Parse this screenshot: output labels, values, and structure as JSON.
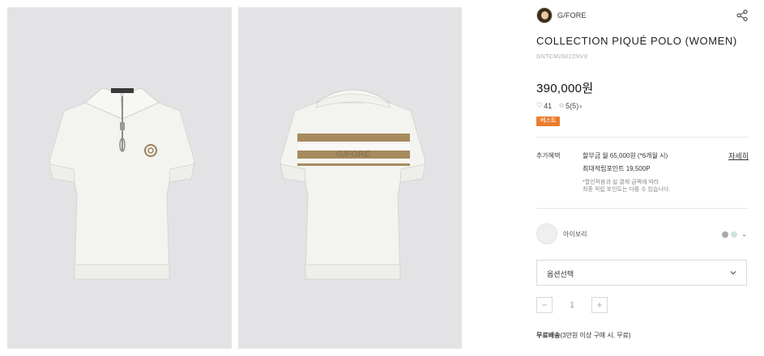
{
  "brand": {
    "name": "G/FORE",
    "logo": "brand-avatar"
  },
  "product": {
    "title": "COLLECTION PIQUÉ POLO (WOMEN)",
    "code": "GNTCM26022NVX",
    "price": "390,000원",
    "likes": "41",
    "rating": "5",
    "review_count": "(5)",
    "badge": "베스트"
  },
  "gallery": {
    "front_wordmark": "G/FORE",
    "back_wordmark": "G/FORE"
  },
  "benefits": {
    "label": "추가혜택",
    "installment": "할부금 월 65,000원 (*6개월 시)",
    "points": "최대적립포인트 19,500P",
    "note_line1": "*할인적용과 실 결제 금액에 따라",
    "note_line2": "최종 적립 포인트는 다를 수 있습니다.",
    "detail_link": "자세히"
  },
  "color": {
    "selected_name": "아이보리",
    "options": [
      {
        "name": "grey",
        "hex": "#a9aaa9"
      },
      {
        "name": "mint",
        "hex": "#cfe3df"
      }
    ],
    "toggle_icon": "chevron-down-icon"
  },
  "option_select": {
    "label": "옵션선택",
    "icon": "chevron-down-icon"
  },
  "quantity": {
    "minus": "−",
    "value": "1",
    "plus": "+"
  },
  "shipping": {
    "bold": "무료배송",
    "text": "(3만원 이상 구매 시, 무료)"
  },
  "colors": {
    "badge": "#ea7e2c",
    "photo_bg": "#e3e3e6",
    "stripe": "#a78b5f"
  }
}
